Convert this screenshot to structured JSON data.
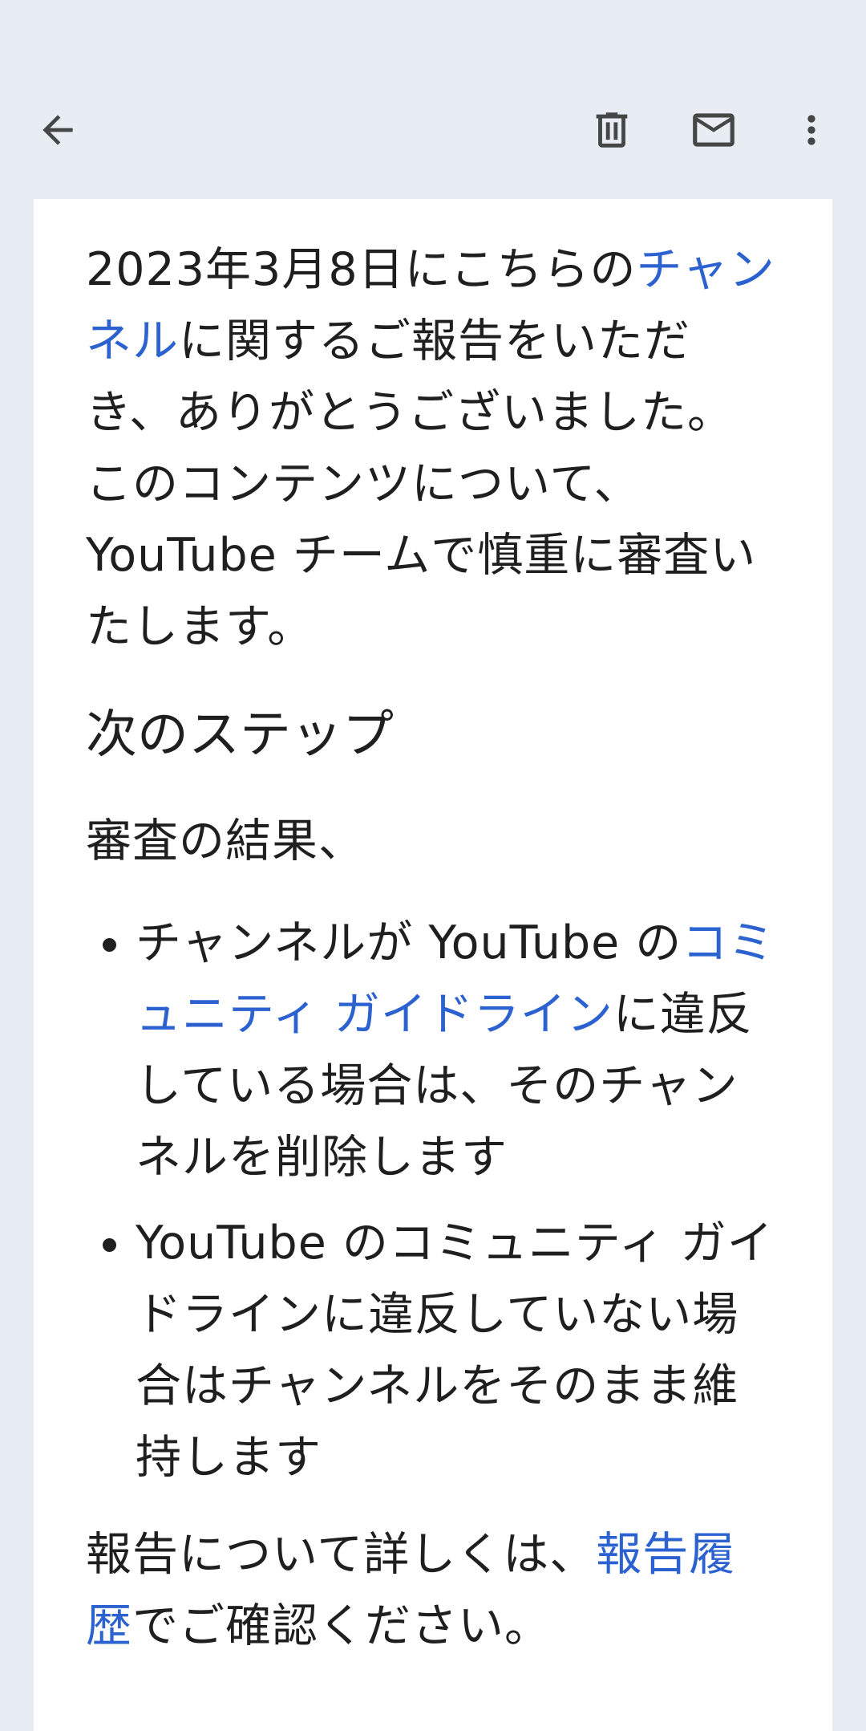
{
  "toolbar": {
    "back_icon": "arrow-back-icon",
    "delete_icon": "trash-icon",
    "mail_icon": "mail-icon",
    "more_icon": "more-vert-icon"
  },
  "email": {
    "para1": {
      "before_link": "2023年3月8日にこちらの",
      "link": "チャンネル",
      "after_link": "に関するご報告をいただき、ありがとうございました。このコンテンツについて、YouTube チームで慎重に審査いたします。"
    },
    "heading": "次のステップ",
    "intro": "審査の結果、",
    "bullets": [
      {
        "before_link": "チャンネルが YouTube の",
        "link": "コミュニティ ガイドライン",
        "after_link": "に違反している場合は、そのチャンネルを削除します"
      },
      {
        "text": "YouTube のコミュニティ ガイドラインに違反していない場合はチャンネルをそのまま維持します"
      }
    ],
    "footer": {
      "before_link": "報告について詳しくは、",
      "link": "報告履歴",
      "after_link": "でご確認ください。"
    }
  },
  "colors": {
    "link": "#2c62d0",
    "app_bar": "#e8edf3"
  }
}
